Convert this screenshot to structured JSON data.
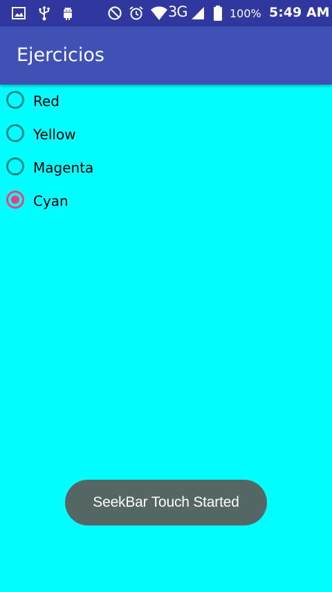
{
  "status_bar": {
    "left_icons": [
      "image-icon",
      "usb-icon",
      "android-icon"
    ],
    "right_icons": [
      "do-not-disturb-icon",
      "alarm-icon",
      "wifi-icon"
    ],
    "network": "3G",
    "battery_percent": "100%",
    "time": "5:49 AM"
  },
  "app_bar": {
    "title": "Ejercicios",
    "color": "#3F51B5"
  },
  "content": {
    "background": "#00FFFF",
    "radio_options": [
      {
        "label": "Red",
        "checked": false
      },
      {
        "label": "Yellow",
        "checked": false
      },
      {
        "label": "Magenta",
        "checked": false
      },
      {
        "label": "Cyan",
        "checked": true
      }
    ]
  },
  "toast": {
    "text": "SeekBar Touch Started"
  },
  "colors": {
    "status_bar": "#3038A0",
    "accent": "#E9427A",
    "radio_unchecked": "#0F8A8C",
    "toast_bg": "#546764"
  }
}
